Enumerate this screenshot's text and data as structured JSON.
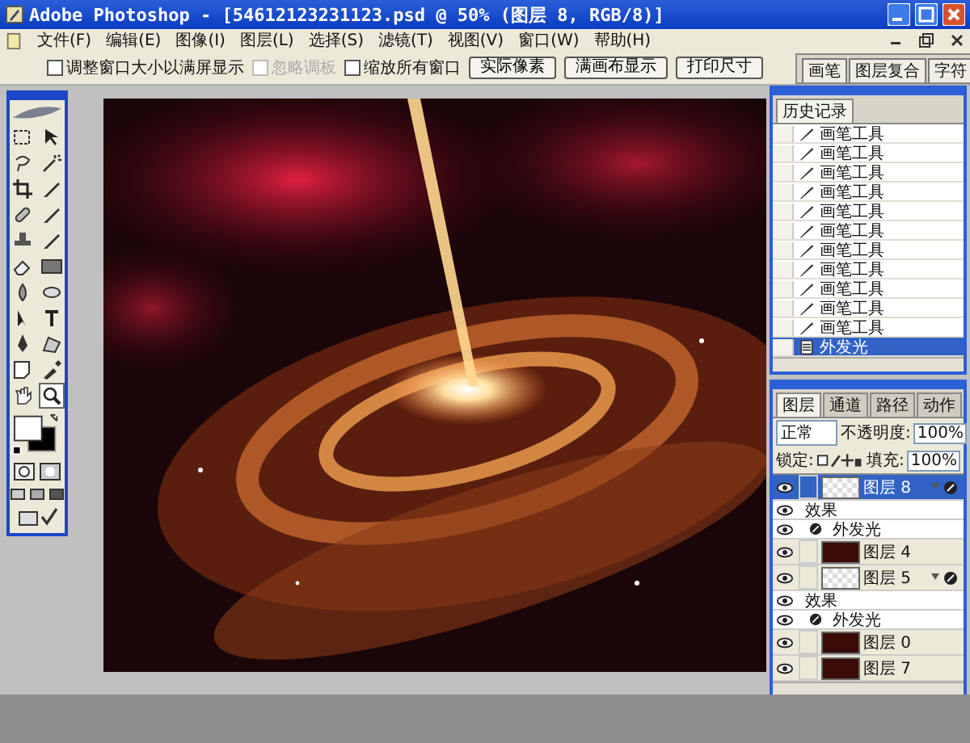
{
  "window": {
    "title": "Adobe Photoshop - [54612123231123.psd @ 50% (图层 8, RGB/8)]"
  },
  "menu": [
    "文件(F)",
    "编辑(E)",
    "图像(I)",
    "图层(L)",
    "选择(S)",
    "滤镜(T)",
    "视图(V)",
    "窗口(W)",
    "帮助(H)"
  ],
  "options_bar": {
    "checkboxes": [
      {
        "label": "调整窗口大小以满屏显示",
        "checked": false,
        "disabled": false
      },
      {
        "label": "忽略调板",
        "checked": false,
        "disabled": true
      },
      {
        "label": "缩放所有窗口",
        "checked": false,
        "disabled": false
      }
    ],
    "buttons": [
      "实际像素",
      "满画布显示",
      "打印尺寸"
    ],
    "palette_well_tabs": [
      "画笔",
      "图层复合",
      "字符"
    ]
  },
  "history": {
    "tab": "历史记录",
    "items": [
      {
        "label": "画笔工具",
        "kind": "brush",
        "selected": false
      },
      {
        "label": "画笔工具",
        "kind": "brush",
        "selected": false
      },
      {
        "label": "画笔工具",
        "kind": "brush",
        "selected": false
      },
      {
        "label": "画笔工具",
        "kind": "brush",
        "selected": false
      },
      {
        "label": "画笔工具",
        "kind": "brush",
        "selected": false
      },
      {
        "label": "画笔工具",
        "kind": "brush",
        "selected": false
      },
      {
        "label": "画笔工具",
        "kind": "brush",
        "selected": false
      },
      {
        "label": "画笔工具",
        "kind": "brush",
        "selected": false
      },
      {
        "label": "画笔工具",
        "kind": "brush",
        "selected": false
      },
      {
        "label": "画笔工具",
        "kind": "brush",
        "selected": false
      },
      {
        "label": "画笔工具",
        "kind": "brush",
        "selected": false
      },
      {
        "label": "外发光",
        "kind": "effect",
        "selected": true
      }
    ]
  },
  "layers": {
    "tabs": [
      {
        "label": "图层",
        "selected": true
      },
      {
        "label": "通道",
        "selected": false
      },
      {
        "label": "路径",
        "selected": false
      },
      {
        "label": "动作",
        "selected": false
      }
    ],
    "blend_mode": "正常",
    "opacity_label": "不透明度:",
    "opacity": "100%",
    "lock_label": "锁定:",
    "fill_label": "填充:",
    "fill": "100%",
    "rows": [
      {
        "kind": "layer",
        "name": "图层 8",
        "transparent_thumb": true,
        "fx": true,
        "visible": true,
        "selected": true
      },
      {
        "kind": "effects",
        "name": "效果",
        "visible": true
      },
      {
        "kind": "effect",
        "name": "外发光",
        "visible": true
      },
      {
        "kind": "layer",
        "name": "图层 4",
        "transparent_thumb": false,
        "fx": false,
        "visible": true,
        "selected": false
      },
      {
        "kind": "layer",
        "name": "图层 5",
        "transparent_thumb": true,
        "fx": true,
        "visible": true,
        "selected": false
      },
      {
        "kind": "effects",
        "name": "效果",
        "visible": true
      },
      {
        "kind": "effect",
        "name": "外发光",
        "visible": true
      },
      {
        "kind": "layer",
        "name": "图层 0",
        "transparent_thumb": false,
        "fx": false,
        "visible": true,
        "selected": false
      },
      {
        "kind": "layer",
        "name": "图层 7",
        "transparent_thumb": false,
        "fx": false,
        "visible": true,
        "selected": false
      }
    ]
  }
}
